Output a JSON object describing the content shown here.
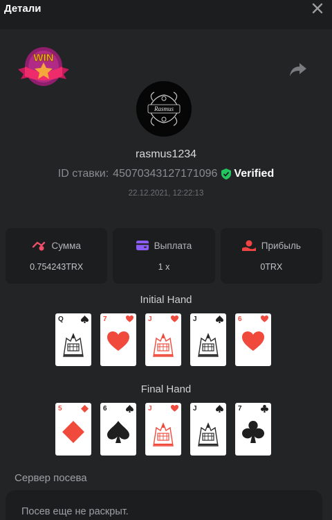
{
  "header": {
    "title": "Детали",
    "close_icon": "close-icon"
  },
  "badge": {
    "text": "WIN"
  },
  "user": {
    "username": "rasmus1234",
    "bet_id_label": "ID ставки:",
    "bet_id": "450703431271710​96",
    "verified_label": "Verified",
    "datetime": "22.12.2021, 12:22:13"
  },
  "stats": [
    {
      "label": "Сумма",
      "value": "0.754243TRX",
      "icon": "sum-icon",
      "color": "#ef4f6a"
    },
    {
      "label": "Выплата",
      "value": "1 x",
      "icon": "wallet-icon",
      "color": "#8b5cf6"
    },
    {
      "label": "Прибыль",
      "value": "0TRX",
      "icon": "profit-icon",
      "color": "#ef4444"
    }
  ],
  "initial_hand": {
    "title": "Initial Hand",
    "cards": [
      {
        "rank": "Q",
        "suit": "spade",
        "color": "black"
      },
      {
        "rank": "7",
        "suit": "heart",
        "color": "red"
      },
      {
        "rank": "J",
        "suit": "heart",
        "color": "red"
      },
      {
        "rank": "J",
        "suit": "spade",
        "color": "black"
      },
      {
        "rank": "6",
        "suit": "heart",
        "color": "red"
      }
    ]
  },
  "final_hand": {
    "title": "Final Hand",
    "cards": [
      {
        "rank": "5",
        "suit": "diamond",
        "color": "red"
      },
      {
        "rank": "6",
        "suit": "spade",
        "color": "black"
      },
      {
        "rank": "J",
        "suit": "heart",
        "color": "red"
      },
      {
        "rank": "J",
        "suit": "spade",
        "color": "black"
      },
      {
        "rank": "7",
        "suit": "club",
        "color": "black"
      }
    ]
  },
  "server": {
    "label": "Сервер посева",
    "seed_text": "Посев еще не раскрыт."
  }
}
